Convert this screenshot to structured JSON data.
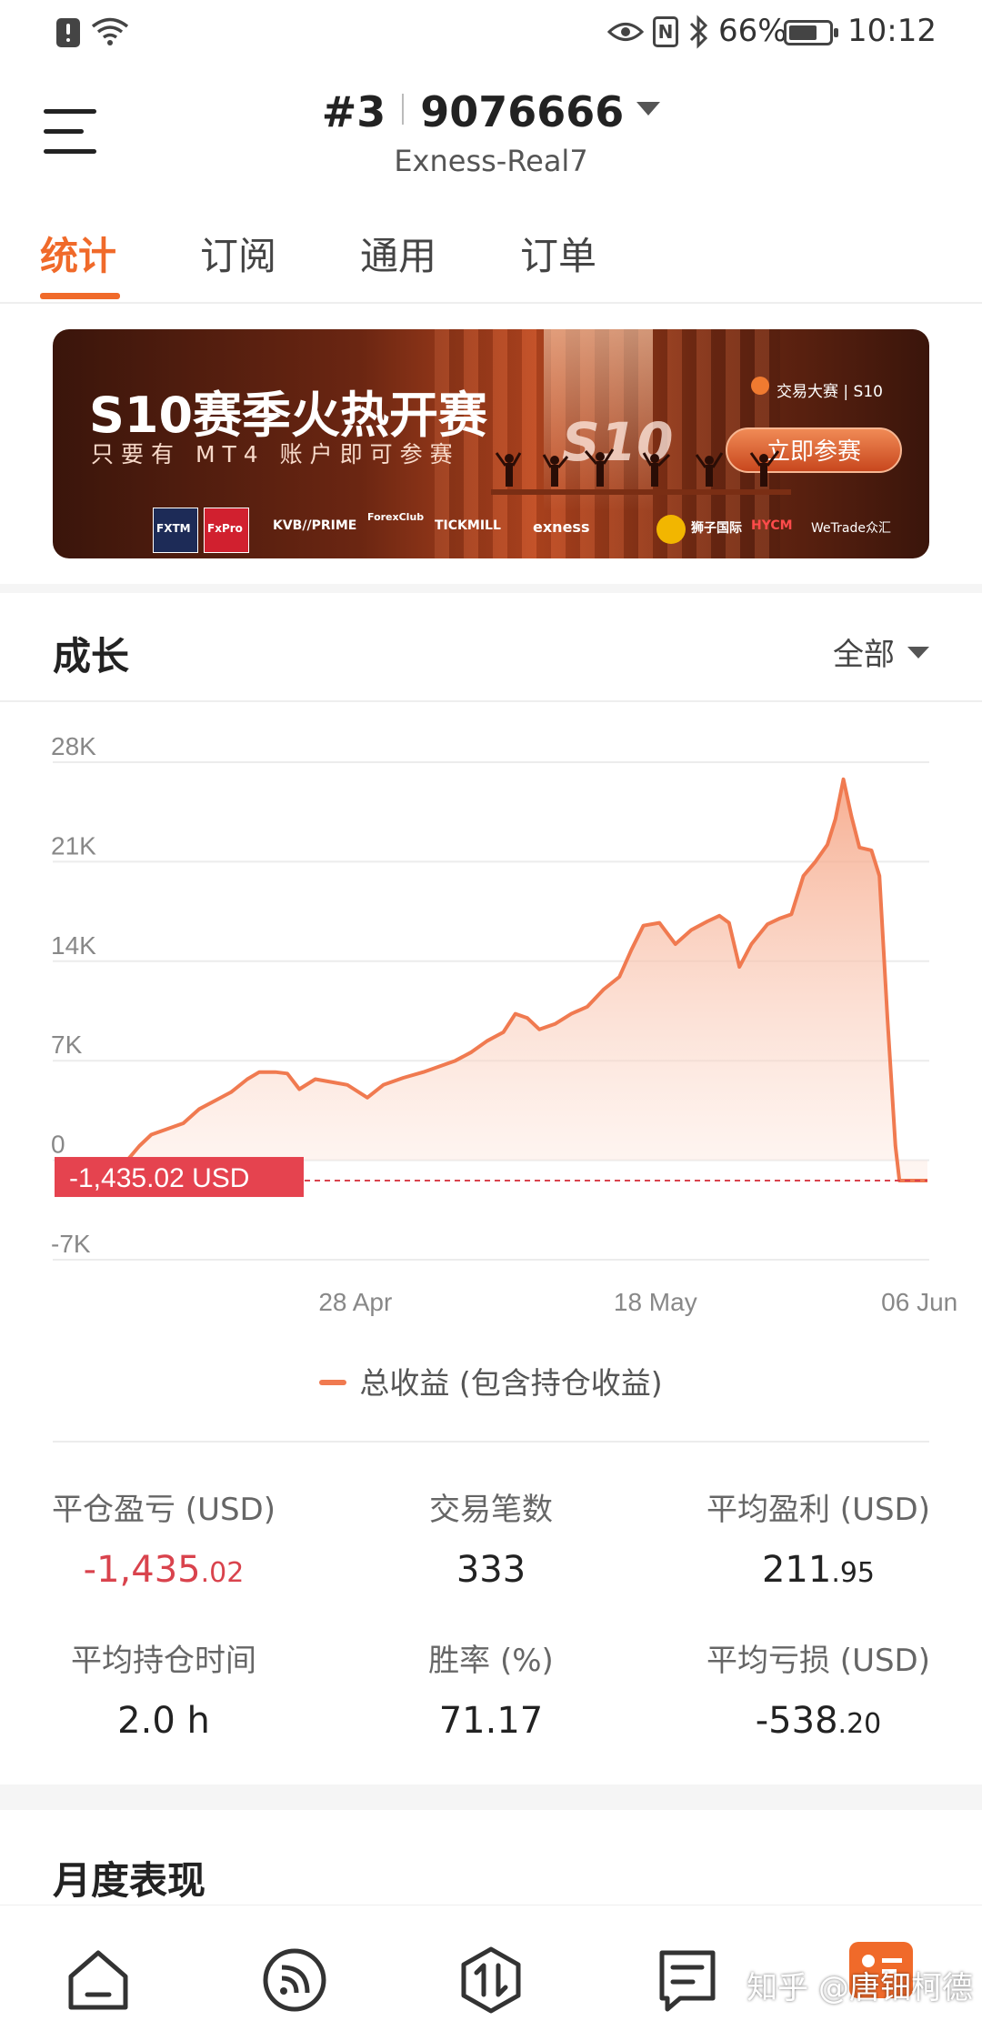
{
  "status_bar": {
    "battery": "66%",
    "time": "10:12"
  },
  "header": {
    "account_rank": "#3",
    "account_number": "9076666",
    "server": "Exness-Real7"
  },
  "tabs": [
    {
      "label": "统计",
      "active": true
    },
    {
      "label": "订阅",
      "active": false
    },
    {
      "label": "通用",
      "active": false
    },
    {
      "label": "订单",
      "active": false
    }
  ],
  "banner": {
    "title": "S10赛季火热开赛",
    "subtitle": "只要有 MT4 账户即可参赛",
    "badge": "S10",
    "contest_tag": "交易大赛 | S10",
    "cta": "立即参赛",
    "sponsors": [
      "FXTM",
      "FxPro",
      "KVB//PRIME",
      "ForexClub",
      "TICKMILL",
      "exness",
      "狮子国际",
      "HYCM",
      "WeTrade众汇"
    ]
  },
  "growth": {
    "title": "成长",
    "filter": "全部",
    "current_value_label": "-1,435.02 USD",
    "legend": "总收益 (包含持仓收益)"
  },
  "chart_data": {
    "type": "area",
    "title": "",
    "xlabel": "",
    "ylabel": "",
    "ylim": [
      -7000,
      28000
    ],
    "yticks": [
      28000,
      21000,
      14000,
      7000,
      0,
      -7000
    ],
    "ytick_labels": [
      "28K",
      "21K",
      "14K",
      "7K",
      "0",
      "-7K"
    ],
    "xticks": [
      {
        "label": "28 Apr",
        "x": 0.285
      },
      {
        "label": "18 May",
        "x": 0.66
      },
      {
        "label": "06 Jun",
        "x": 0.99
      }
    ],
    "grid": true,
    "color": "#f07a50",
    "reference_line": -1435.02,
    "series": [
      {
        "name": "总收益 (包含持仓收益)",
        "points": [
          [
            0.0,
            0
          ],
          [
            0.015,
            1000
          ],
          [
            0.03,
            1800
          ],
          [
            0.05,
            2200
          ],
          [
            0.07,
            2600
          ],
          [
            0.09,
            3600
          ],
          [
            0.11,
            4200
          ],
          [
            0.13,
            4800
          ],
          [
            0.15,
            5700
          ],
          [
            0.165,
            6200
          ],
          [
            0.185,
            6200
          ],
          [
            0.2,
            6100
          ],
          [
            0.215,
            5000
          ],
          [
            0.235,
            5700
          ],
          [
            0.255,
            5500
          ],
          [
            0.275,
            5300
          ],
          [
            0.3,
            4400
          ],
          [
            0.32,
            5300
          ],
          [
            0.345,
            5800
          ],
          [
            0.37,
            6200
          ],
          [
            0.39,
            6600
          ],
          [
            0.41,
            7000
          ],
          [
            0.43,
            7600
          ],
          [
            0.45,
            8400
          ],
          [
            0.47,
            9000
          ],
          [
            0.485,
            10300
          ],
          [
            0.5,
            10000
          ],
          [
            0.515,
            9200
          ],
          [
            0.535,
            9600
          ],
          [
            0.555,
            10300
          ],
          [
            0.575,
            10800
          ],
          [
            0.595,
            12000
          ],
          [
            0.615,
            12900
          ],
          [
            0.63,
            14800
          ],
          [
            0.645,
            16500
          ],
          [
            0.665,
            16700
          ],
          [
            0.685,
            15200
          ],
          [
            0.705,
            16200
          ],
          [
            0.725,
            16800
          ],
          [
            0.74,
            17200
          ],
          [
            0.752,
            16700
          ],
          [
            0.765,
            13600
          ],
          [
            0.78,
            15200
          ],
          [
            0.8,
            16600
          ],
          [
            0.815,
            17000
          ],
          [
            0.83,
            17300
          ],
          [
            0.845,
            20000
          ],
          [
            0.86,
            21000
          ],
          [
            0.875,
            22200
          ],
          [
            0.885,
            24000
          ],
          [
            0.895,
            26800
          ],
          [
            0.905,
            24200
          ],
          [
            0.915,
            22000
          ],
          [
            0.93,
            21800
          ],
          [
            0.94,
            20000
          ],
          [
            0.95,
            10000
          ],
          [
            0.96,
            1000
          ],
          [
            0.965,
            -1435
          ],
          [
            1.0,
            -1435
          ]
        ]
      }
    ]
  },
  "stats": [
    {
      "label": "平仓盈亏 (USD)",
      "value_main": "-1,435",
      "value_frac": ".02",
      "negative": true
    },
    {
      "label": "交易笔数",
      "value_main": "333",
      "value_frac": "",
      "negative": false
    },
    {
      "label": "平均盈利 (USD)",
      "value_main": "211",
      "value_frac": ".95",
      "negative": false
    },
    {
      "label": "平均持仓时间",
      "value_main": "2.0 h",
      "value_frac": "",
      "negative": false
    },
    {
      "label": "胜率 (%)",
      "value_main": "71.17",
      "value_frac": "",
      "negative": false
    },
    {
      "label": "平均亏损 (USD)",
      "value_main": "-538",
      "value_frac": ".20",
      "negative": false
    }
  ],
  "monthly_title": "月度表现",
  "bottom_nav": [
    {
      "icon": "home-icon"
    },
    {
      "icon": "signal-feed-icon"
    },
    {
      "icon": "trade-exchange-icon"
    },
    {
      "icon": "news-icon"
    },
    {
      "icon": "profile-icon"
    }
  ],
  "watermark": "知乎 @唐钿柯德"
}
